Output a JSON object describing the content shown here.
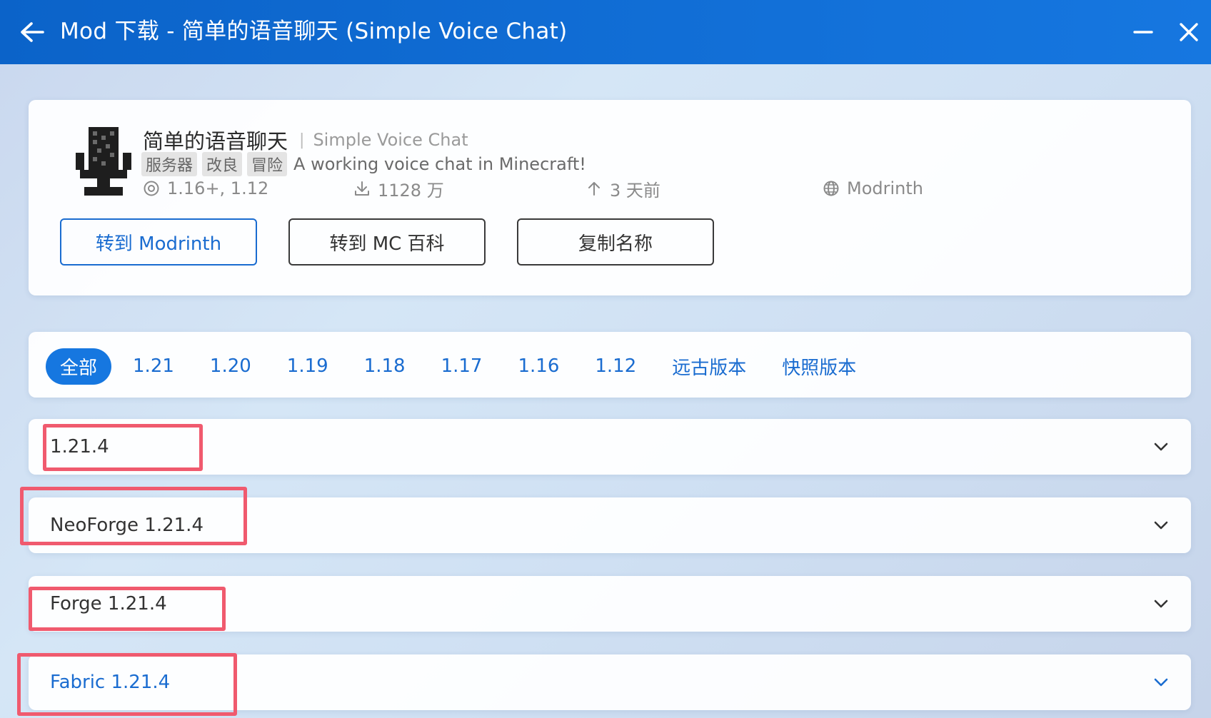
{
  "titlebar": {
    "title": "Mod 下载 - 简单的语音聊天 (Simple Voice Chat)"
  },
  "mod": {
    "name_cn": "简单的语音聊天",
    "separator": "|",
    "name_en": "Simple Voice Chat",
    "tags": [
      "服务器",
      "改良",
      "冒险"
    ],
    "description": "A working voice chat in Minecraft!",
    "versions": "1.16+, 1.12",
    "downloads": "1128 万",
    "updated": "3 天前",
    "source": "Modrinth"
  },
  "buttons": {
    "modrinth": "转到 Modrinth",
    "mcwiki": "转到 MC 百科",
    "copy": "复制名称"
  },
  "filters": [
    "全部",
    "1.21",
    "1.20",
    "1.19",
    "1.18",
    "1.17",
    "1.16",
    "1.12",
    "远古版本",
    "快照版本"
  ],
  "rows": [
    "1.21.4",
    "NeoForge 1.21.4",
    "Forge 1.21.4",
    "Fabric 1.21.4"
  ],
  "colors": {
    "accent": "#1677e0",
    "highlight": "#f05a6e"
  }
}
